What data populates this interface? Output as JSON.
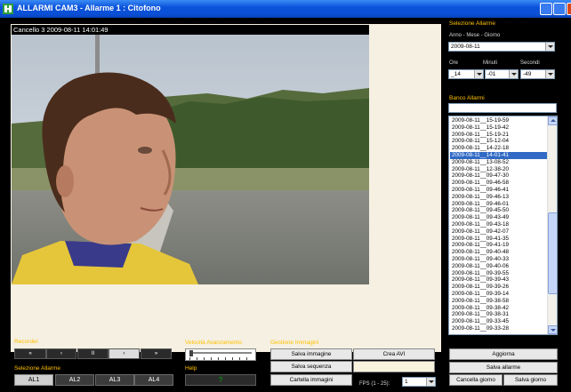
{
  "window": {
    "title": "ALLARMI CAM3 - Allarme 1 : Citofono"
  },
  "video": {
    "overlay_text": "Cancello 3 2009-08-11 14:01:49"
  },
  "selezione_allarme": {
    "header": "Selezione Allarme",
    "date_label": "Anno - Mese - Giorno",
    "date_value": "2009-08-11",
    "ore_label": "Ore",
    "minuti_label": "Minuti",
    "secondi_label": "Secondi",
    "ore_value": "_14",
    "minuti_value": "-01",
    "secondi_value": "-49"
  },
  "banco_allarmi": {
    "header": "Banco Allarmi",
    "filter_value": "",
    "items": [
      "2009-08-11__15-19-59",
      "2009-08-11__15-19-42",
      "2009-08-11__15-19-21",
      "2009-08-11__15-12-04",
      "2009-08-11__14-22-18",
      "2009-08-11__14-01-41",
      "2009-08-11__13-08-52",
      "2009-08-11__12-38-20",
      "2009-08-11__09-47-30",
      "2009-08-11__09-46-58",
      "2009-08-11__09-46-41",
      "2009-08-11__09-46-13",
      "2009-08-11__09-46-01",
      "2009-08-11__09-45-50",
      "2009-08-11__09-43-49",
      "2009-08-11__09-43-18",
      "2009-08-11__09-42-07",
      "2009-08-11__09-41-35",
      "2009-08-11__09-41-19",
      "2009-08-11__09-40-48",
      "2009-08-11__09-40-33",
      "2009-08-11__09-40-06",
      "2009-08-11__09-39-55",
      "2009-08-11__09-39-43",
      "2009-08-11__09-39-26",
      "2009-08-11__09-39-14",
      "2009-08-11__09-38-58",
      "2009-08-11__09-38-42",
      "2009-08-11__09-38-31",
      "2009-08-11__09-33-45",
      "2009-08-11__09-33-28"
    ],
    "selected_index": 5
  },
  "recorder": {
    "header": "Recorder",
    "buttons": [
      "«",
      "‹",
      "II",
      "›",
      "»"
    ]
  },
  "selezione_allarme_bottom": {
    "header": "Selezione Allarme",
    "buttons": [
      "AL1",
      "AL2",
      "AL3",
      "AL4"
    ]
  },
  "velocita": {
    "header": "Velocità Avanzamento",
    "level": 0
  },
  "help": {
    "header": "Help",
    "button": "?"
  },
  "gestione": {
    "header": "Gestione Immagini",
    "salva_immagine": "Salva immagine",
    "crea_avi": "Crea AVI",
    "salva_sequenza": "Salva sequenza",
    "cartella_immagini": "Cartella immagini",
    "fps_label": "FPS (1 - 25):",
    "fps_value": "1"
  },
  "actions": {
    "aggiorna": "Aggiorna",
    "salva_allarme": "Salva allarme",
    "cancella_giorno": "Cancella giorno",
    "salva_giorno": "Salva giorno"
  },
  "colors": {
    "title_bar": "#0a4fd6",
    "label_accent": "#ffc000",
    "video_background": "#f5f0e1",
    "selection": "#316ac5"
  }
}
